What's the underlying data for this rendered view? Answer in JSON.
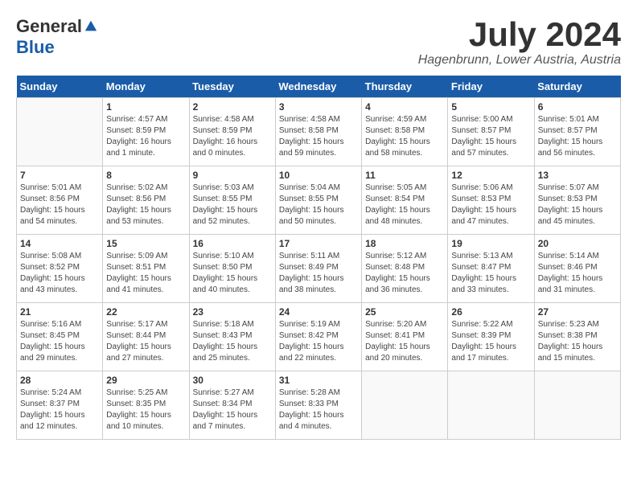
{
  "header": {
    "logo": {
      "general": "General",
      "blue": "Blue"
    },
    "title": "July 2024",
    "location": "Hagenbrunn, Lower Austria, Austria"
  },
  "weekdays": [
    "Sunday",
    "Monday",
    "Tuesday",
    "Wednesday",
    "Thursday",
    "Friday",
    "Saturday"
  ],
  "weeks": [
    [
      {
        "day": "",
        "sunrise": "",
        "sunset": "",
        "daylight": ""
      },
      {
        "day": "1",
        "sunrise": "Sunrise: 4:57 AM",
        "sunset": "Sunset: 8:59 PM",
        "daylight": "Daylight: 16 hours and 1 minute."
      },
      {
        "day": "2",
        "sunrise": "Sunrise: 4:58 AM",
        "sunset": "Sunset: 8:59 PM",
        "daylight": "Daylight: 16 hours and 0 minutes."
      },
      {
        "day": "3",
        "sunrise": "Sunrise: 4:58 AM",
        "sunset": "Sunset: 8:58 PM",
        "daylight": "Daylight: 15 hours and 59 minutes."
      },
      {
        "day": "4",
        "sunrise": "Sunrise: 4:59 AM",
        "sunset": "Sunset: 8:58 PM",
        "daylight": "Daylight: 15 hours and 58 minutes."
      },
      {
        "day": "5",
        "sunrise": "Sunrise: 5:00 AM",
        "sunset": "Sunset: 8:57 PM",
        "daylight": "Daylight: 15 hours and 57 minutes."
      },
      {
        "day": "6",
        "sunrise": "Sunrise: 5:01 AM",
        "sunset": "Sunset: 8:57 PM",
        "daylight": "Daylight: 15 hours and 56 minutes."
      }
    ],
    [
      {
        "day": "7",
        "sunrise": "Sunrise: 5:01 AM",
        "sunset": "Sunset: 8:56 PM",
        "daylight": "Daylight: 15 hours and 54 minutes."
      },
      {
        "day": "8",
        "sunrise": "Sunrise: 5:02 AM",
        "sunset": "Sunset: 8:56 PM",
        "daylight": "Daylight: 15 hours and 53 minutes."
      },
      {
        "day": "9",
        "sunrise": "Sunrise: 5:03 AM",
        "sunset": "Sunset: 8:55 PM",
        "daylight": "Daylight: 15 hours and 52 minutes."
      },
      {
        "day": "10",
        "sunrise": "Sunrise: 5:04 AM",
        "sunset": "Sunset: 8:55 PM",
        "daylight": "Daylight: 15 hours and 50 minutes."
      },
      {
        "day": "11",
        "sunrise": "Sunrise: 5:05 AM",
        "sunset": "Sunset: 8:54 PM",
        "daylight": "Daylight: 15 hours and 48 minutes."
      },
      {
        "day": "12",
        "sunrise": "Sunrise: 5:06 AM",
        "sunset": "Sunset: 8:53 PM",
        "daylight": "Daylight: 15 hours and 47 minutes."
      },
      {
        "day": "13",
        "sunrise": "Sunrise: 5:07 AM",
        "sunset": "Sunset: 8:53 PM",
        "daylight": "Daylight: 15 hours and 45 minutes."
      }
    ],
    [
      {
        "day": "14",
        "sunrise": "Sunrise: 5:08 AM",
        "sunset": "Sunset: 8:52 PM",
        "daylight": "Daylight: 15 hours and 43 minutes."
      },
      {
        "day": "15",
        "sunrise": "Sunrise: 5:09 AM",
        "sunset": "Sunset: 8:51 PM",
        "daylight": "Daylight: 15 hours and 41 minutes."
      },
      {
        "day": "16",
        "sunrise": "Sunrise: 5:10 AM",
        "sunset": "Sunset: 8:50 PM",
        "daylight": "Daylight: 15 hours and 40 minutes."
      },
      {
        "day": "17",
        "sunrise": "Sunrise: 5:11 AM",
        "sunset": "Sunset: 8:49 PM",
        "daylight": "Daylight: 15 hours and 38 minutes."
      },
      {
        "day": "18",
        "sunrise": "Sunrise: 5:12 AM",
        "sunset": "Sunset: 8:48 PM",
        "daylight": "Daylight: 15 hours and 36 minutes."
      },
      {
        "day": "19",
        "sunrise": "Sunrise: 5:13 AM",
        "sunset": "Sunset: 8:47 PM",
        "daylight": "Daylight: 15 hours and 33 minutes."
      },
      {
        "day": "20",
        "sunrise": "Sunrise: 5:14 AM",
        "sunset": "Sunset: 8:46 PM",
        "daylight": "Daylight: 15 hours and 31 minutes."
      }
    ],
    [
      {
        "day": "21",
        "sunrise": "Sunrise: 5:16 AM",
        "sunset": "Sunset: 8:45 PM",
        "daylight": "Daylight: 15 hours and 29 minutes."
      },
      {
        "day": "22",
        "sunrise": "Sunrise: 5:17 AM",
        "sunset": "Sunset: 8:44 PM",
        "daylight": "Daylight: 15 hours and 27 minutes."
      },
      {
        "day": "23",
        "sunrise": "Sunrise: 5:18 AM",
        "sunset": "Sunset: 8:43 PM",
        "daylight": "Daylight: 15 hours and 25 minutes."
      },
      {
        "day": "24",
        "sunrise": "Sunrise: 5:19 AM",
        "sunset": "Sunset: 8:42 PM",
        "daylight": "Daylight: 15 hours and 22 minutes."
      },
      {
        "day": "25",
        "sunrise": "Sunrise: 5:20 AM",
        "sunset": "Sunset: 8:41 PM",
        "daylight": "Daylight: 15 hours and 20 minutes."
      },
      {
        "day": "26",
        "sunrise": "Sunrise: 5:22 AM",
        "sunset": "Sunset: 8:39 PM",
        "daylight": "Daylight: 15 hours and 17 minutes."
      },
      {
        "day": "27",
        "sunrise": "Sunrise: 5:23 AM",
        "sunset": "Sunset: 8:38 PM",
        "daylight": "Daylight: 15 hours and 15 minutes."
      }
    ],
    [
      {
        "day": "28",
        "sunrise": "Sunrise: 5:24 AM",
        "sunset": "Sunset: 8:37 PM",
        "daylight": "Daylight: 15 hours and 12 minutes."
      },
      {
        "day": "29",
        "sunrise": "Sunrise: 5:25 AM",
        "sunset": "Sunset: 8:35 PM",
        "daylight": "Daylight: 15 hours and 10 minutes."
      },
      {
        "day": "30",
        "sunrise": "Sunrise: 5:27 AM",
        "sunset": "Sunset: 8:34 PM",
        "daylight": "Daylight: 15 hours and 7 minutes."
      },
      {
        "day": "31",
        "sunrise": "Sunrise: 5:28 AM",
        "sunset": "Sunset: 8:33 PM",
        "daylight": "Daylight: 15 hours and 4 minutes."
      },
      {
        "day": "",
        "sunrise": "",
        "sunset": "",
        "daylight": ""
      },
      {
        "day": "",
        "sunrise": "",
        "sunset": "",
        "daylight": ""
      },
      {
        "day": "",
        "sunrise": "",
        "sunset": "",
        "daylight": ""
      }
    ]
  ]
}
